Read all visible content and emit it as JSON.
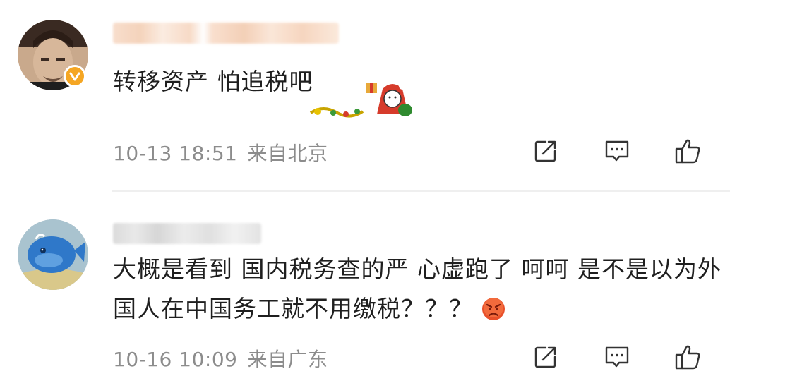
{
  "comments": [
    {
      "text": "转移资产 怕追税吧",
      "time": "10-13 18:51",
      "location": "来自北京",
      "verified": true
    },
    {
      "text": "大概是看到 国内税务查的严 心虚跑了 呵呵 是不是以为外国人在中国务工就不用缴税？？？",
      "time": "10-16 10:09",
      "location": "来自广东",
      "verified": false
    }
  ],
  "icons": {
    "share": "share-icon",
    "comment": "comment-icon",
    "like": "thumbs-up-icon",
    "verified": "verified-badge-icon",
    "emoji": "angry-face-emoji",
    "sticker": "christmas-sticker"
  },
  "colors": {
    "meta_text": "#8c8c8c",
    "verified_badge": "#f5a623",
    "divider": "#efefef"
  }
}
